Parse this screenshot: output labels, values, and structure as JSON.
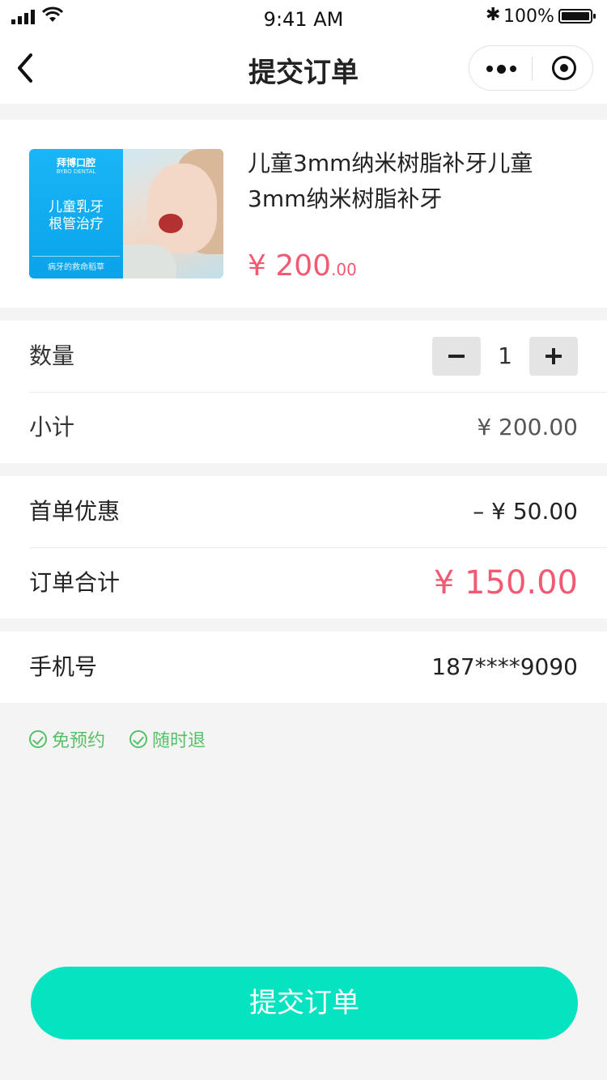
{
  "status_bar": {
    "time": "9:41 AM",
    "battery_percent": "100%",
    "battery_level": 1.0
  },
  "nav": {
    "title": "提交订单",
    "back_icon": "chevron-left-icon",
    "more_icon": "more-dots-icon",
    "close_icon": "record-target-icon"
  },
  "product": {
    "image": {
      "brand": "拜博口腔",
      "brand_en": "BYBO DENTAL",
      "headline_1": "儿童乳牙",
      "headline_2": "根管治疗",
      "slogan": "病牙的救命稻草"
    },
    "title": "儿童3mm纳米树脂补牙儿童3mm纳米树脂补牙",
    "price_main": "¥ 200",
    "price_cents": ".00"
  },
  "quantity": {
    "label": "数量",
    "value": "1"
  },
  "subtotal": {
    "label": "小计",
    "value": "¥ 200.00"
  },
  "discount": {
    "label": "首单优惠",
    "value": "– ¥ 50.00"
  },
  "total": {
    "label": "订单合计",
    "value": "¥ 150.00"
  },
  "phone": {
    "label": "手机号",
    "value": "187****9090"
  },
  "tags": [
    "免预约",
    "随时退"
  ],
  "submit_label": "提交订单",
  "colors": {
    "accent": "#05e3c0",
    "price": "#f25a74",
    "tag": "#56c068"
  }
}
